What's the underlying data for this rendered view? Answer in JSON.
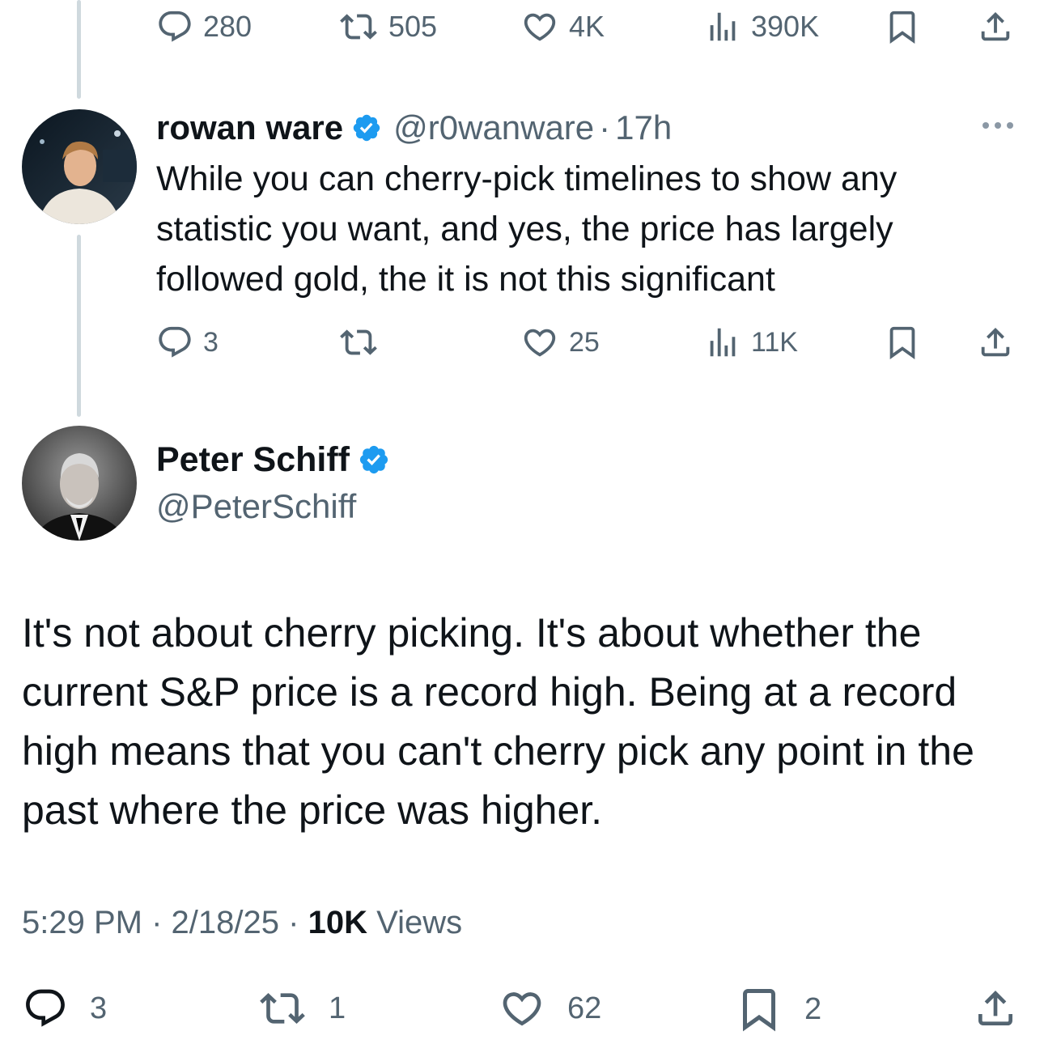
{
  "top_actions": {
    "replies": "280",
    "reposts": "505",
    "likes": "4K",
    "views": "390K"
  },
  "reply_tweet": {
    "display_name": "rowan ware",
    "handle": "@r0wanware",
    "separator": "·",
    "time": "17h",
    "text": "While you can cherry-pick timelines to show any statistic you want, and yes, the price has largely followed gold, the it is not this significant",
    "actions": {
      "replies": "3",
      "reposts": "",
      "likes": "25",
      "views": "11K"
    }
  },
  "main_tweet": {
    "display_name": "Peter Schiff",
    "handle": "@PeterSchiff",
    "text": "It's not about cherry picking. It's about whether the current S&P price is a record high. Being at a record high means that you can't cherry pick any point in the past where the price was higher.",
    "time": "5:29 PM",
    "date": "2/18/25",
    "separator": "·",
    "views_count": "10K",
    "views_label": "Views",
    "actions": {
      "replies": "3",
      "reposts": "1",
      "likes": "62",
      "bookmarks": "2"
    }
  },
  "colors": {
    "verified_blue": "#1d9bf0",
    "muted_gray": "#536471",
    "text_black": "#0f1419",
    "thread_line": "#cfd9de"
  }
}
